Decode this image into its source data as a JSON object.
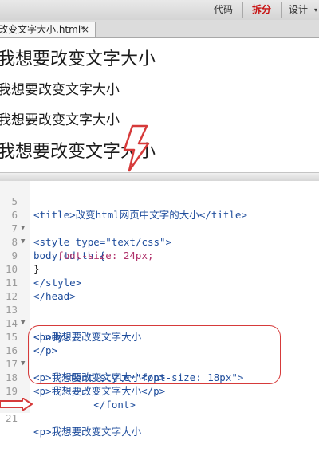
{
  "toolbar": {
    "code_label": "代码",
    "split_label": "拆分",
    "design_label": "设计"
  },
  "tab": {
    "title": "改变文字大小.html*",
    "close": "×"
  },
  "preview": {
    "lines": [
      "我想要改变文字大小",
      "我想要改变文字大小",
      "我想要改变文字大小",
      "我想要改变文字大小"
    ]
  },
  "code": {
    "lines": [
      {
        "n": "5",
        "fold": "",
        "text": "<title>改变html网页中文字的大小</title>"
      },
      {
        "n": "6",
        "fold": "▼",
        "text": "<style type=\"text/css\">"
      },
      {
        "n": "7",
        "fold": "▼",
        "text": "body,td,th {"
      },
      {
        "n": "8",
        "fold": "",
        "text": "    font-size: 24px;"
      },
      {
        "n": "9",
        "fold": "",
        "text": "}"
      },
      {
        "n": "10",
        "fold": "",
        "text": "</style>"
      },
      {
        "n": "11",
        "fold": "",
        "text": "</head>"
      },
      {
        "n": "12",
        "fold": "",
        "text": ""
      },
      {
        "n": "13",
        "fold": "▼",
        "text": "<body>"
      },
      {
        "n": "14",
        "fold": "",
        "text": "<p>我想要改变文字大小"
      },
      {
        "n": "15",
        "fold": "",
        "text": "</p>"
      },
      {
        "n": "16",
        "fold": "▼",
        "text": "     <font style=\"font-size: 18px\">"
      },
      {
        "n": "17",
        "fold": "",
        "text": "<p>我想要改变文字大小</p>"
      },
      {
        "n": "18",
        "fold": "",
        "text": "<p>我想要改变文字大小</p>"
      },
      {
        "n": "19",
        "fold": "",
        "text": "          </font>"
      },
      {
        "n": "20",
        "fold": "",
        "text": ""
      },
      {
        "n": "21",
        "fold": "",
        "text": "<p>我想要改变文字大小"
      }
    ]
  },
  "colors": {
    "accent_red": "#d63a3a",
    "tag_blue": "#1f4d9c",
    "string_pink": "#b0316a"
  }
}
